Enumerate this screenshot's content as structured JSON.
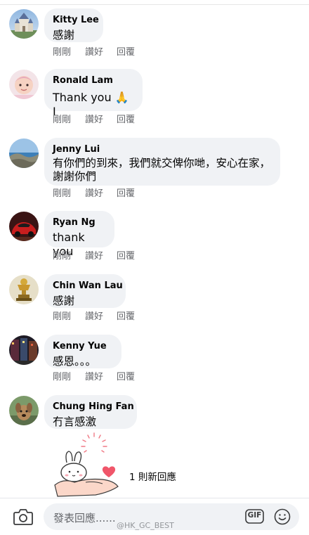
{
  "comments": [
    {
      "name": "Kitty Lee",
      "text": "感謝",
      "avatar": "avatar-castle-photo"
    },
    {
      "name": "Ronald Lam",
      "text": "Thank you 🙏 I",
      "avatar": "avatar-baby-photo"
    },
    {
      "name": "Jenny Lui",
      "text": "有你們的到來，我們就交俾你哋，安心在家，謝謝你們",
      "avatar": "avatar-coast-photo"
    },
    {
      "name": "Ryan Ng",
      "text": "thank you",
      "avatar": "avatar-red-car-photo"
    },
    {
      "name": "Chin Wan Lau",
      "text": "感謝",
      "avatar": "avatar-trophy-photo"
    },
    {
      "name": "Kenny Yue",
      "text": "感恩。。。",
      "avatar": "avatar-street-photo"
    },
    {
      "name": "Chung Hing Fan",
      "text": "冇言感激",
      "avatar": "avatar-dog-photo"
    }
  ],
  "actions": {
    "time": "剛剛",
    "like": "讚好",
    "reply": "回覆"
  },
  "replies": {
    "label": "1 則新回應",
    "sticker": "bunny-heart-hand-sticker"
  },
  "composer": {
    "placeholder": "發表回應......",
    "gif_label": "GIF"
  },
  "watermark": "@HK_GC_BEST",
  "colors": {
    "bubble": "#f0f2f5",
    "secondary_text": "#65676b",
    "heart": "#f0566a"
  }
}
